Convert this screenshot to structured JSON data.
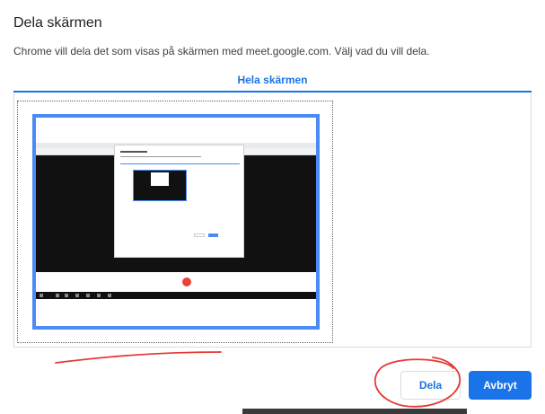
{
  "dialog": {
    "title": "Dela skärmen",
    "description": "Chrome vill dela det som visas på skärmen med meet.google.com. Välj vad du vill dela.",
    "tab_label": "Hela skärmen"
  },
  "buttons": {
    "share_label": "Dela",
    "cancel_label": "Avbryt"
  },
  "colors": {
    "accent": "#1a73e8",
    "selection_border": "#4c8bf5",
    "annotation": "#e53935"
  },
  "annotations": {
    "underline_icon": "red-freehand-underline",
    "circle_icon": "red-freehand-circle"
  }
}
